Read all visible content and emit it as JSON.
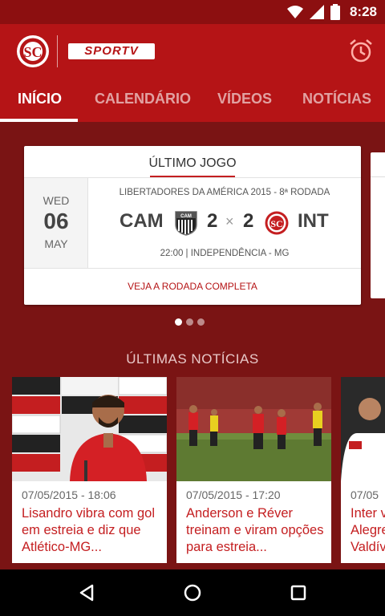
{
  "status_bar": {
    "time": "8:28",
    "icons": [
      "wifi-icon",
      "signal-icon",
      "battery-icon"
    ]
  },
  "app_bar": {
    "brand": "SPORTV",
    "alarm_icon": "alarm-clock-icon",
    "logo_icon": "club-crest-icon"
  },
  "tabs": [
    {
      "label": "INÍCIO",
      "active": true
    },
    {
      "label": "CALENDÁRIO",
      "active": false
    },
    {
      "label": "VÍDEOS",
      "active": false
    },
    {
      "label": "NOTÍCIAS",
      "active": false
    }
  ],
  "last_game": {
    "title": "ÚLTIMO JOGO",
    "weekday": "WED",
    "day": "06",
    "month": "MAY",
    "competition": "LIBERTADORES DA AMÉRICA 2015 - 8ª RODADA",
    "home_team": "CAM",
    "home_score": "2",
    "separator": "×",
    "away_score": "2",
    "away_team": "INT",
    "venue": "22:00 | INDEPENDÊNCIA - MG",
    "link": "VEJA A RODADA COMPLETA"
  },
  "carousel": {
    "pages": 3,
    "active": 0
  },
  "news_section": {
    "title": "ÚLTIMAS NOTÍCIAS",
    "items": [
      {
        "timestamp": "07/05/2015 - 18:06",
        "headline": "Lisandro vibra com gol em estreia e diz que Atlético-MG..."
      },
      {
        "timestamp": "07/05/2015 - 17:20",
        "headline": "Anderson e Réver treinam e viram opções para estreia..."
      },
      {
        "timestamp": "07/05",
        "headline": "Inter v Alegre Valdív"
      }
    ]
  },
  "colors": {
    "primary": "#b51416",
    "dark": "#7a1414",
    "status": "#8c0f10",
    "accent_text": "#c41e20"
  },
  "nav": {
    "back": "back-icon",
    "home": "home-icon",
    "recents": "recents-icon"
  }
}
